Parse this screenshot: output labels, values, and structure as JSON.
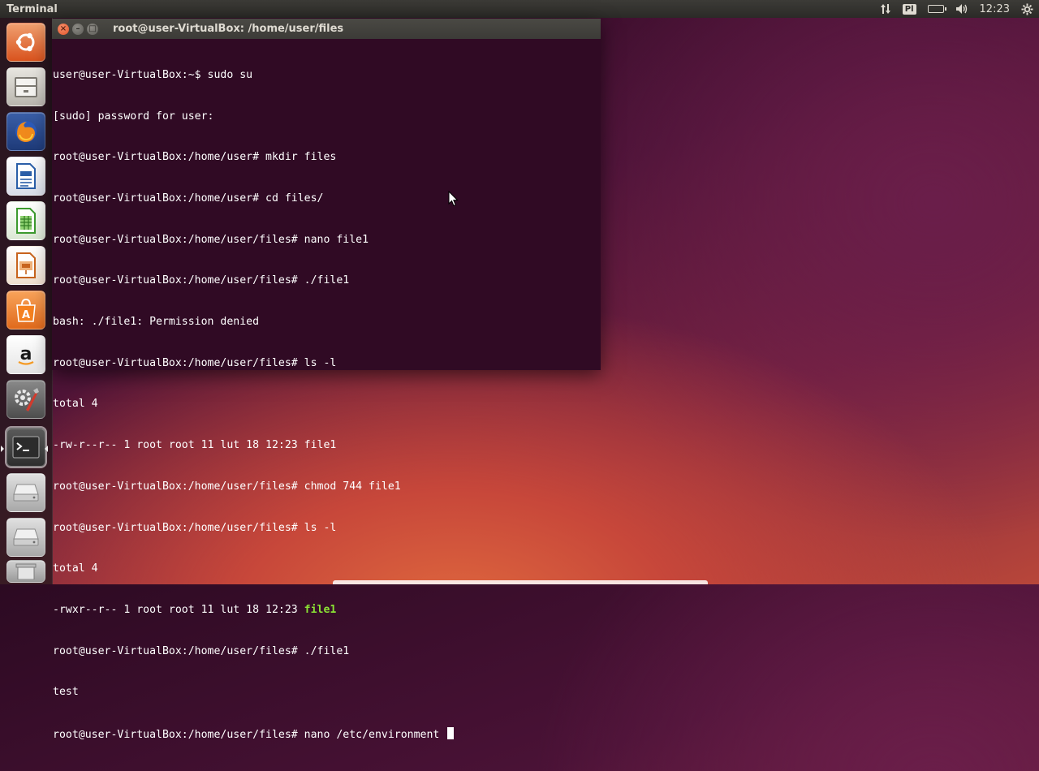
{
  "top_panel": {
    "app_title": "Terminal",
    "keyboard_layout": "Pl",
    "time": "12:23",
    "icons": [
      "network-arrows-icon",
      "keyboard-layout-icon",
      "battery-icon",
      "volume-icon",
      "gear-icon"
    ]
  },
  "window": {
    "title": "root@user-VirtualBox: /home/user/files",
    "buttons": [
      "close-icon",
      "minimize-icon",
      "maximize-icon"
    ]
  },
  "terminal": {
    "lines": [
      "user@user-VirtualBox:~$ sudo su",
      "[sudo] password for user:",
      "root@user-VirtualBox:/home/user# mkdir files",
      "root@user-VirtualBox:/home/user# cd files/",
      "root@user-VirtualBox:/home/user/files# nano file1",
      "root@user-VirtualBox:/home/user/files# ./file1",
      "bash: ./file1: Permission denied",
      "root@user-VirtualBox:/home/user/files# ls -l",
      "total 4",
      "-rw-r--r-- 1 root root 11 lut 18 12:23 file1",
      "root@user-VirtualBox:/home/user/files# chmod 744 file1",
      "root@user-VirtualBox:/home/user/files# ls -l",
      "total 4"
    ],
    "exec_listing_prefix": "-rwxr--r-- 1 root root 11 lut 18 12:23 ",
    "exec_listing_file": "file1",
    "after_lines": [
      "root@user-VirtualBox:/home/user/files# ./file1",
      "test"
    ],
    "current_prompt": "root@user-VirtualBox:/home/user/files# nano /etc/environment ",
    "colors": {
      "background": "#300a24",
      "text": "#ffffff",
      "executable": "#8ae234"
    }
  },
  "launcher": {
    "items": [
      {
        "name": "ubuntu-dash-icon"
      },
      {
        "name": "files-icon"
      },
      {
        "name": "firefox-icon"
      },
      {
        "name": "libreoffice-writer-icon"
      },
      {
        "name": "libreoffice-calc-icon"
      },
      {
        "name": "libreoffice-impress-icon"
      },
      {
        "name": "software-center-icon"
      },
      {
        "name": "amazon-icon"
      },
      {
        "name": "system-settings-icon"
      },
      {
        "name": "terminal-icon",
        "active": true
      },
      {
        "name": "drive-icon"
      },
      {
        "name": "drive-icon"
      },
      {
        "name": "trash-icon"
      }
    ],
    "amazon_glyph": "a"
  }
}
